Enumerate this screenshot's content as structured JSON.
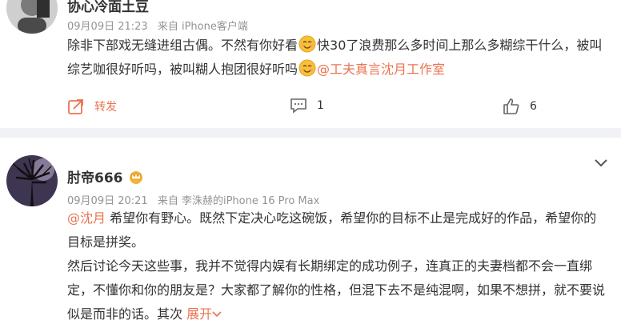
{
  "post1": {
    "username": "协心冷面土豆",
    "time": "09月09日 21:23",
    "source": "来自 iPhone客户端",
    "text_a": "除非下部戏无缝进组古偶。不然有你好看",
    "text_b": "快30了浪费那么多时间上那么多糊综干什么，被叫综艺咖很好听吗，被叫糊人抱团很好听吗",
    "mention": "@工夫真言沈月工作室",
    "repost_label": "转发",
    "comment_count": "1",
    "like_count": "6",
    "avatar_icon": "avatar-photo"
  },
  "post2": {
    "username": "肘帝666",
    "time": "09月09日 20:21",
    "source": "来自 李洙赫的iPhone 16 Pro Max",
    "mention": "@沈月",
    "para1": "希望你有野心。既然下定决心吃这碗饭，希望你的目标不止是完成好的作品，希望你的目标是拼奖。",
    "para2": "然后讨论今天这些事，我并不觉得内娱有长期绑定的成功例子，连真正的夫妻档都不会一直绑定，不懂你和你的朋友是？大家都了解你的性格，但混下去不是纯混啊，如果不想拼，就不要说似是而非的话。其次",
    "expand_label": "展开",
    "badge_icon": "crown-badge-icon",
    "avatar_icon": "avatar-tree-silhouette"
  },
  "colors": {
    "accent": "#eb7350",
    "meta": "#939393",
    "separator": "#f1f2f5"
  }
}
